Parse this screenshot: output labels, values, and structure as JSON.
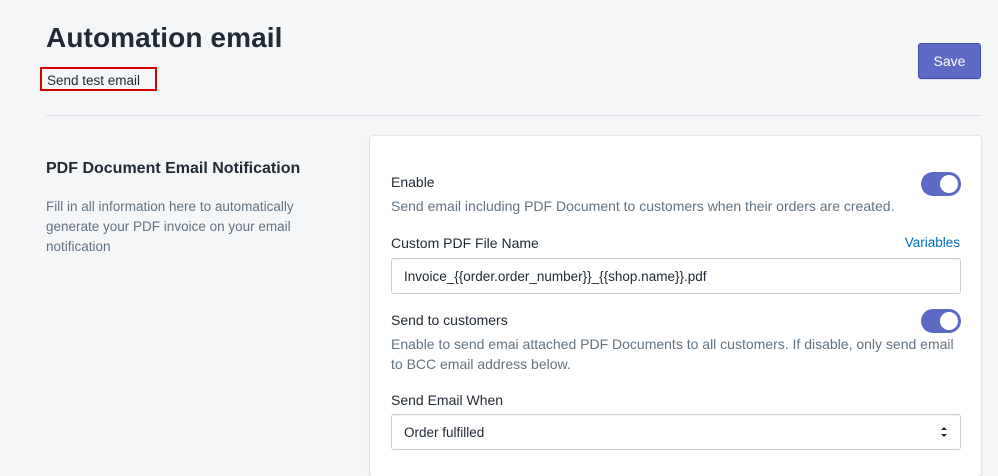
{
  "header": {
    "title": "Automation email",
    "test_link": "Send test email",
    "save_label": "Save"
  },
  "section": {
    "title": "PDF Document Email Notification",
    "description": "Fill in all information here to automatically generate your PDF invoice on your email notification"
  },
  "form": {
    "enable": {
      "label": "Enable",
      "help": "Send email including PDF Document to customers when their orders are created.",
      "on": true
    },
    "file_name": {
      "label": "Custom PDF File Name",
      "variables_link": "Variables",
      "value": "Invoice_{{order.order_number}}_{{shop.name}}.pdf"
    },
    "send_to_customers": {
      "label": "Send to customers",
      "help": "Enable to send emai attached PDF Documents to all customers. If disable, only send email to BCC email address below.",
      "on": true
    },
    "send_when": {
      "label": "Send Email When",
      "selected": "Order fulfilled"
    }
  },
  "colors": {
    "accent": "#5c6ac4",
    "link": "#006fbb",
    "highlight_border": "#d40000"
  }
}
